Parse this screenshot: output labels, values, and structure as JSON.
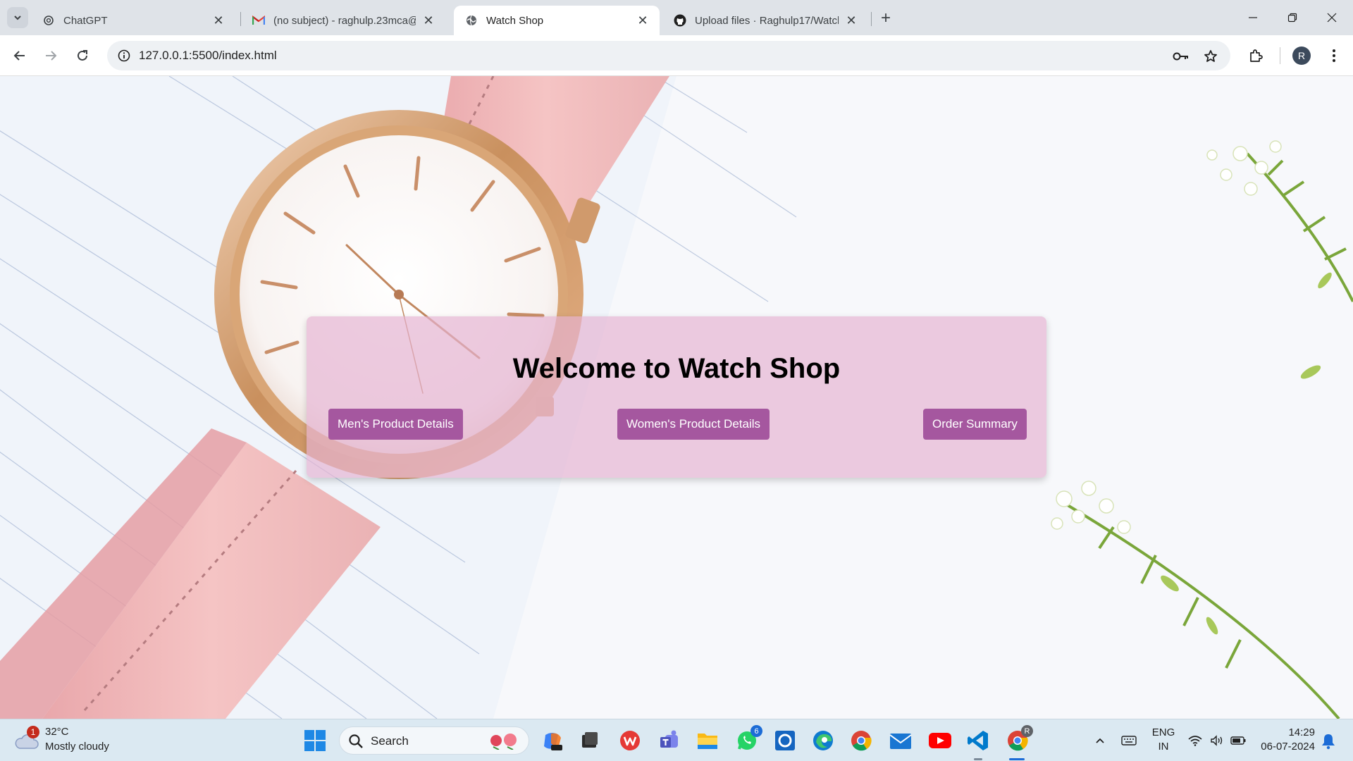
{
  "browser": {
    "tabs": [
      {
        "title": "ChatGPT",
        "favicon": "chatgpt-icon",
        "active": false
      },
      {
        "title": "(no subject) - raghulp.23mca@",
        "favicon": "gmail-icon",
        "active": false
      },
      {
        "title": "Watch Shop",
        "favicon": "globe-icon",
        "active": true
      },
      {
        "title": "Upload files · Raghulp17/Watch",
        "favicon": "github-icon",
        "active": false
      }
    ],
    "url": "127.0.0.1:5500/index.html",
    "profile_initial": "R"
  },
  "page": {
    "heading": "Welcome to Watch Shop",
    "buttons": {
      "mens": "Men's Product Details",
      "womens": "Women's Product Details",
      "order": "Order Summary"
    },
    "colors": {
      "panel": "#e4b2d2",
      "button": "#a5579f",
      "button_text": "#ffffff"
    }
  },
  "taskbar": {
    "weather": {
      "temp": "32°C",
      "condition": "Mostly cloudy",
      "badge": "1"
    },
    "search_label": "Search",
    "apps": [
      "copilot-icon",
      "terminal-icon",
      "wps-icon",
      "teams-icon",
      "file-explorer-icon",
      "whatsapp-icon",
      "app-icon",
      "edge-icon",
      "chrome-icon",
      "mail-icon",
      "youtube-icon",
      "vscode-icon",
      "chrome-profile-icon"
    ],
    "whatsapp_badge": "6",
    "chrome_profile_badge": "R",
    "language": {
      "line1": "ENG",
      "line2": "IN"
    },
    "time": "14:29",
    "date": "06-07-2024"
  }
}
